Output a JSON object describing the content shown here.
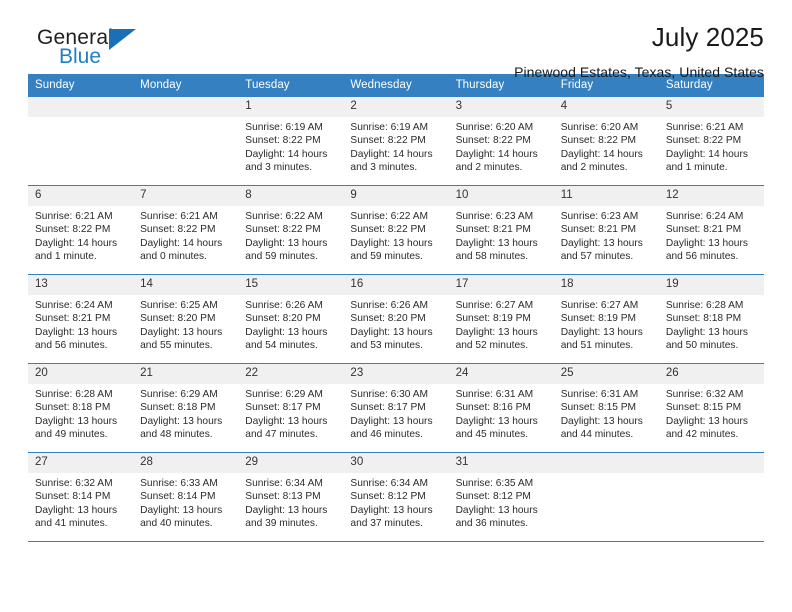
{
  "brand": {
    "name_top": "General",
    "name_bottom": "Blue",
    "accent_color": "#1b6fb5",
    "logo_icon": "triangle-flag-icon"
  },
  "header": {
    "title": "July 2025",
    "subtitle": "Pinewood Estates, Texas, United States"
  },
  "calendar": {
    "header_bg": "#3580c0",
    "daynum_bg": "#f0f0f0",
    "weekday_headers": [
      "Sunday",
      "Monday",
      "Tuesday",
      "Wednesday",
      "Thursday",
      "Friday",
      "Saturday"
    ],
    "weeks": [
      [
        {
          "day": "",
          "lines": []
        },
        {
          "day": "",
          "lines": []
        },
        {
          "day": "1",
          "lines": [
            "Sunrise: 6:19 AM",
            "Sunset: 8:22 PM",
            "Daylight: 14 hours",
            "and 3 minutes."
          ]
        },
        {
          "day": "2",
          "lines": [
            "Sunrise: 6:19 AM",
            "Sunset: 8:22 PM",
            "Daylight: 14 hours",
            "and 3 minutes."
          ]
        },
        {
          "day": "3",
          "lines": [
            "Sunrise: 6:20 AM",
            "Sunset: 8:22 PM",
            "Daylight: 14 hours",
            "and 2 minutes."
          ]
        },
        {
          "day": "4",
          "lines": [
            "Sunrise: 6:20 AM",
            "Sunset: 8:22 PM",
            "Daylight: 14 hours",
            "and 2 minutes."
          ]
        },
        {
          "day": "5",
          "lines": [
            "Sunrise: 6:21 AM",
            "Sunset: 8:22 PM",
            "Daylight: 14 hours",
            "and 1 minute."
          ]
        }
      ],
      [
        {
          "day": "6",
          "lines": [
            "Sunrise: 6:21 AM",
            "Sunset: 8:22 PM",
            "Daylight: 14 hours",
            "and 1 minute."
          ]
        },
        {
          "day": "7",
          "lines": [
            "Sunrise: 6:21 AM",
            "Sunset: 8:22 PM",
            "Daylight: 14 hours",
            "and 0 minutes."
          ]
        },
        {
          "day": "8",
          "lines": [
            "Sunrise: 6:22 AM",
            "Sunset: 8:22 PM",
            "Daylight: 13 hours",
            "and 59 minutes."
          ]
        },
        {
          "day": "9",
          "lines": [
            "Sunrise: 6:22 AM",
            "Sunset: 8:22 PM",
            "Daylight: 13 hours",
            "and 59 minutes."
          ]
        },
        {
          "day": "10",
          "lines": [
            "Sunrise: 6:23 AM",
            "Sunset: 8:21 PM",
            "Daylight: 13 hours",
            "and 58 minutes."
          ]
        },
        {
          "day": "11",
          "lines": [
            "Sunrise: 6:23 AM",
            "Sunset: 8:21 PM",
            "Daylight: 13 hours",
            "and 57 minutes."
          ]
        },
        {
          "day": "12",
          "lines": [
            "Sunrise: 6:24 AM",
            "Sunset: 8:21 PM",
            "Daylight: 13 hours",
            "and 56 minutes."
          ]
        }
      ],
      [
        {
          "day": "13",
          "lines": [
            "Sunrise: 6:24 AM",
            "Sunset: 8:21 PM",
            "Daylight: 13 hours",
            "and 56 minutes."
          ]
        },
        {
          "day": "14",
          "lines": [
            "Sunrise: 6:25 AM",
            "Sunset: 8:20 PM",
            "Daylight: 13 hours",
            "and 55 minutes."
          ]
        },
        {
          "day": "15",
          "lines": [
            "Sunrise: 6:26 AM",
            "Sunset: 8:20 PM",
            "Daylight: 13 hours",
            "and 54 minutes."
          ]
        },
        {
          "day": "16",
          "lines": [
            "Sunrise: 6:26 AM",
            "Sunset: 8:20 PM",
            "Daylight: 13 hours",
            "and 53 minutes."
          ]
        },
        {
          "day": "17",
          "lines": [
            "Sunrise: 6:27 AM",
            "Sunset: 8:19 PM",
            "Daylight: 13 hours",
            "and 52 minutes."
          ]
        },
        {
          "day": "18",
          "lines": [
            "Sunrise: 6:27 AM",
            "Sunset: 8:19 PM",
            "Daylight: 13 hours",
            "and 51 minutes."
          ]
        },
        {
          "day": "19",
          "lines": [
            "Sunrise: 6:28 AM",
            "Sunset: 8:18 PM",
            "Daylight: 13 hours",
            "and 50 minutes."
          ]
        }
      ],
      [
        {
          "day": "20",
          "lines": [
            "Sunrise: 6:28 AM",
            "Sunset: 8:18 PM",
            "Daylight: 13 hours",
            "and 49 minutes."
          ]
        },
        {
          "day": "21",
          "lines": [
            "Sunrise: 6:29 AM",
            "Sunset: 8:18 PM",
            "Daylight: 13 hours",
            "and 48 minutes."
          ]
        },
        {
          "day": "22",
          "lines": [
            "Sunrise: 6:29 AM",
            "Sunset: 8:17 PM",
            "Daylight: 13 hours",
            "and 47 minutes."
          ]
        },
        {
          "day": "23",
          "lines": [
            "Sunrise: 6:30 AM",
            "Sunset: 8:17 PM",
            "Daylight: 13 hours",
            "and 46 minutes."
          ]
        },
        {
          "day": "24",
          "lines": [
            "Sunrise: 6:31 AM",
            "Sunset: 8:16 PM",
            "Daylight: 13 hours",
            "and 45 minutes."
          ]
        },
        {
          "day": "25",
          "lines": [
            "Sunrise: 6:31 AM",
            "Sunset: 8:15 PM",
            "Daylight: 13 hours",
            "and 44 minutes."
          ]
        },
        {
          "day": "26",
          "lines": [
            "Sunrise: 6:32 AM",
            "Sunset: 8:15 PM",
            "Daylight: 13 hours",
            "and 42 minutes."
          ]
        }
      ],
      [
        {
          "day": "27",
          "lines": [
            "Sunrise: 6:32 AM",
            "Sunset: 8:14 PM",
            "Daylight: 13 hours",
            "and 41 minutes."
          ]
        },
        {
          "day": "28",
          "lines": [
            "Sunrise: 6:33 AM",
            "Sunset: 8:14 PM",
            "Daylight: 13 hours",
            "and 40 minutes."
          ]
        },
        {
          "day": "29",
          "lines": [
            "Sunrise: 6:34 AM",
            "Sunset: 8:13 PM",
            "Daylight: 13 hours",
            "and 39 minutes."
          ]
        },
        {
          "day": "30",
          "lines": [
            "Sunrise: 6:34 AM",
            "Sunset: 8:12 PM",
            "Daylight: 13 hours",
            "and 37 minutes."
          ]
        },
        {
          "day": "31",
          "lines": [
            "Sunrise: 6:35 AM",
            "Sunset: 8:12 PM",
            "Daylight: 13 hours",
            "and 36 minutes."
          ]
        },
        {
          "day": "",
          "lines": []
        },
        {
          "day": "",
          "lines": []
        }
      ]
    ]
  }
}
